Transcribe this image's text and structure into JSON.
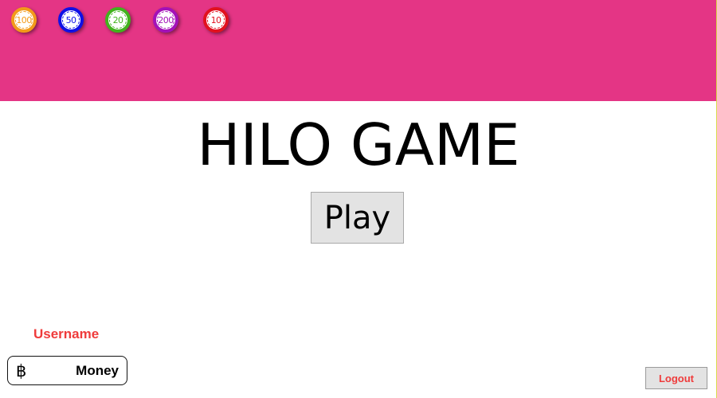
{
  "chips": [
    {
      "value": "100",
      "color": "#f39a1a",
      "name": "chip-100"
    },
    {
      "value": "50",
      "color": "#1010e6",
      "name": "chip-50"
    },
    {
      "value": "20",
      "color": "#42b31d",
      "name": "chip-20"
    },
    {
      "value": "200",
      "color": "#a311b8",
      "name": "chip-200"
    },
    {
      "value": "10",
      "color": "#e2111f",
      "name": "chip-10"
    }
  ],
  "game": {
    "title": "HILO GAME",
    "play_label": "Play"
  },
  "player": {
    "username": "Username",
    "currency_symbol": "฿",
    "currency_icon": "baht-icon",
    "money_label": "Money"
  },
  "actions": {
    "logout_label": "Logout"
  },
  "colors": {
    "banner": "#e43585",
    "accent_red": "#ef3b3b"
  }
}
